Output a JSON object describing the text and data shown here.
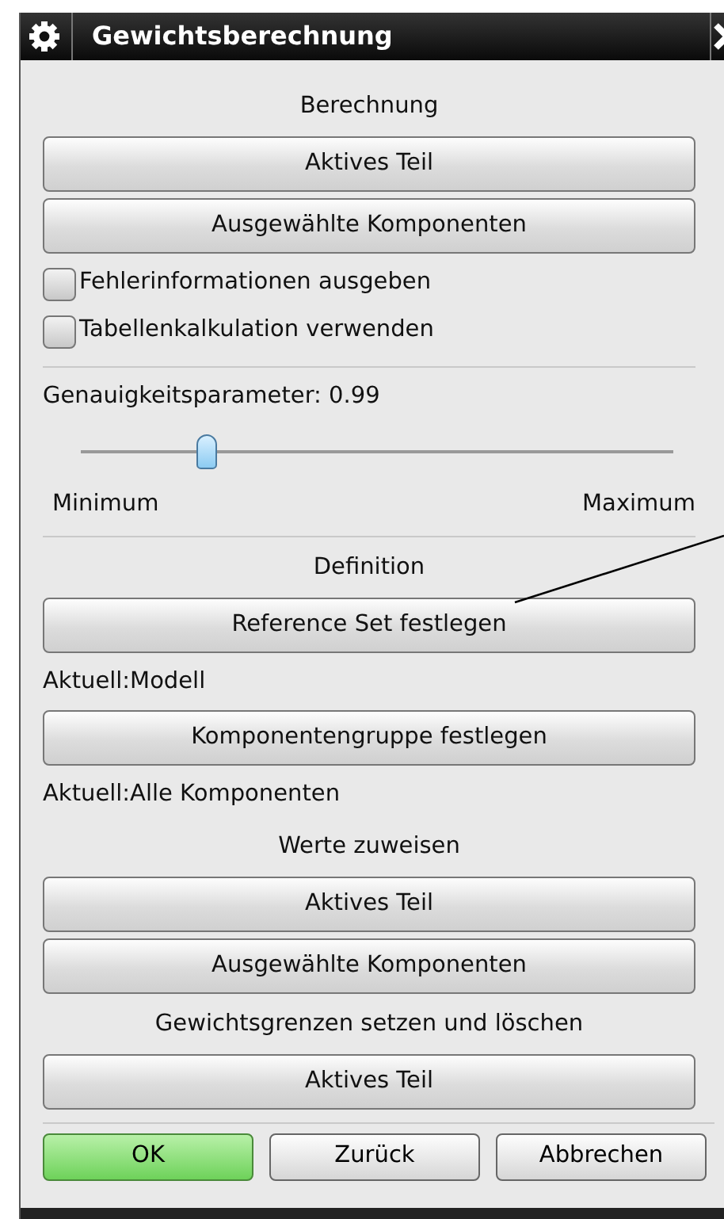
{
  "window": {
    "title": "Gewichtsberechnung"
  },
  "items": [
    {
      "kind": "heading",
      "text": "Berechnung"
    },
    {
      "kind": "button",
      "label": "Aktives Teil"
    },
    {
      "kind": "button",
      "label": "Ausgewählte Komponenten"
    },
    {
      "kind": "checkbox",
      "label": "Fehlerinformationen ausgeben",
      "checked": false
    },
    {
      "kind": "checkbox",
      "label": "Tabellenkalkulation verwenden",
      "checked": false
    },
    {
      "kind": "divider"
    },
    {
      "kind": "slider",
      "label": "Genauigkeitsparameter: 0.99",
      "level": 0.21,
      "min_label": "Minimum",
      "max_label": "Maximum"
    },
    {
      "kind": "divider"
    },
    {
      "kind": "heading",
      "text": "Definition"
    },
    {
      "kind": "button",
      "label": "Reference Set festlegen"
    },
    {
      "kind": "text",
      "text": "Aktuell:Modell"
    },
    {
      "kind": "button",
      "label": "Komponentengruppe festlegen"
    },
    {
      "kind": "text",
      "text": "Aktuell:Alle Komponenten"
    },
    {
      "kind": "heading",
      "text": "Werte zuweisen"
    },
    {
      "kind": "button",
      "label": "Aktives Teil"
    },
    {
      "kind": "button",
      "label": "Ausgewählte Komponenten"
    },
    {
      "kind": "heading",
      "text": "Gewichtsgrenzen setzen und löschen"
    },
    {
      "kind": "button",
      "label": "Aktives Teil"
    }
  ],
  "footer_buttons": [
    {
      "label": "OK",
      "default": true
    },
    {
      "label": "Zurück",
      "default": false
    },
    {
      "label": "Abbrechen",
      "default": false
    }
  ]
}
